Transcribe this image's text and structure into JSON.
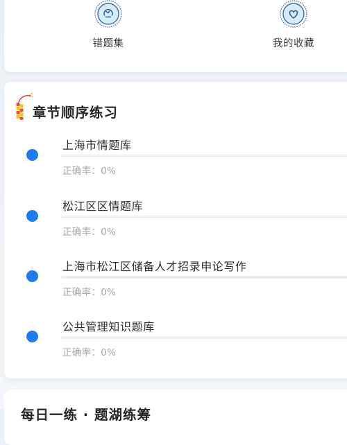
{
  "quick_entries": [
    {
      "label": "错题集",
      "icon": "wrong-questions-icon"
    },
    {
      "label": "我的收藏",
      "icon": "favorites-heart-icon"
    }
  ],
  "chapter_section": {
    "title": "章节顺序练习",
    "icon": "firecracker-icon",
    "items": [
      {
        "name": "上海市情题库",
        "accuracy_text": "正确率：0%",
        "accuracy_percent": 0
      },
      {
        "name": "松江区区情题库",
        "accuracy_text": "正确率：0%",
        "accuracy_percent": 0
      },
      {
        "name": "上海市松江区储备人才招录申论写作",
        "accuracy_text": "正确率：0%",
        "accuracy_percent": 0
      },
      {
        "name": "公共管理知识题库",
        "accuracy_text": "正确率：0%",
        "accuracy_percent": 0
      }
    ]
  },
  "daily_section": {
    "title": "每日一练 · 题湖练筹"
  },
  "colors": {
    "accent": "#1f7cf0",
    "icon_ring": "#3a6ea8",
    "icon_fill": "#d6ecf8",
    "muted_text": "#a6a6a6"
  }
}
